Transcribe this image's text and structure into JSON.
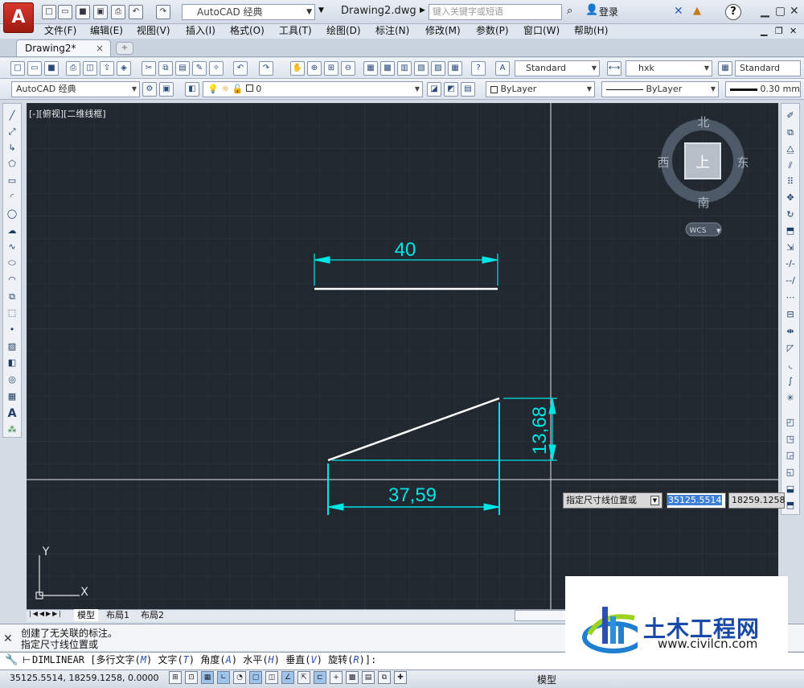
{
  "titlebar": {
    "workspace": "AutoCAD 经典",
    "document_title": "Drawing2.dwg",
    "search_placeholder": "键入关键字或短语",
    "login": "登录",
    "help": "?"
  },
  "menu": [
    "文件(F)",
    "编辑(E)",
    "视图(V)",
    "插入(I)",
    "格式(O)",
    "工具(T)",
    "绘图(D)",
    "标注(N)",
    "修改(M)",
    "参数(P)",
    "窗口(W)",
    "帮助(H)"
  ],
  "doc_tab": {
    "label": "Drawing2*",
    "close": "×"
  },
  "styles_toolbar": {
    "text_style": "Standard",
    "dim_style": "hxk",
    "table_style": "Standard"
  },
  "layers_toolbar": {
    "workspace": "AutoCAD 经典",
    "layer": "0",
    "color": "ByLayer",
    "linetype": "ByLayer",
    "lineweight": "0.30 mm"
  },
  "viewport": {
    "label": "[-][俯视][二维线框]",
    "viewcube": {
      "north": "北",
      "south": "南",
      "west": "西",
      "east": "东",
      "face": "上",
      "ucs": "WCS"
    },
    "ucs_axes": {
      "x": "X",
      "y": "Y"
    }
  },
  "drawing": {
    "dim_top": "40",
    "dim_bottom": "37,59",
    "dim_right": "13,68",
    "line_color": "#ffffff",
    "dim_color": "#00e5e5"
  },
  "dynamic_input": {
    "prompt": "指定尺寸线位置或",
    "x_value": "35125.5514",
    "y_value": "18259.1258"
  },
  "layout_tabs": [
    "模型",
    "布局1",
    "布局2"
  ],
  "command": {
    "history": [
      "创建了无关联的标注。",
      "指定尺寸线位置或"
    ],
    "name": "DIMLINEAR",
    "options": [
      {
        "label": "多行文字",
        "key": "M"
      },
      {
        "label": "文字",
        "key": "T"
      },
      {
        "label": "角度",
        "key": "A"
      },
      {
        "label": "水平",
        "key": "H"
      },
      {
        "label": "垂直",
        "key": "V"
      },
      {
        "label": "旋转",
        "key": "R"
      }
    ]
  },
  "status": {
    "coordinates": "35125.5514, 18259.1258, 0.0000",
    "model_label": "模型"
  },
  "watermark": {
    "title": "土木工程网",
    "url": "www.civilcn.com"
  }
}
